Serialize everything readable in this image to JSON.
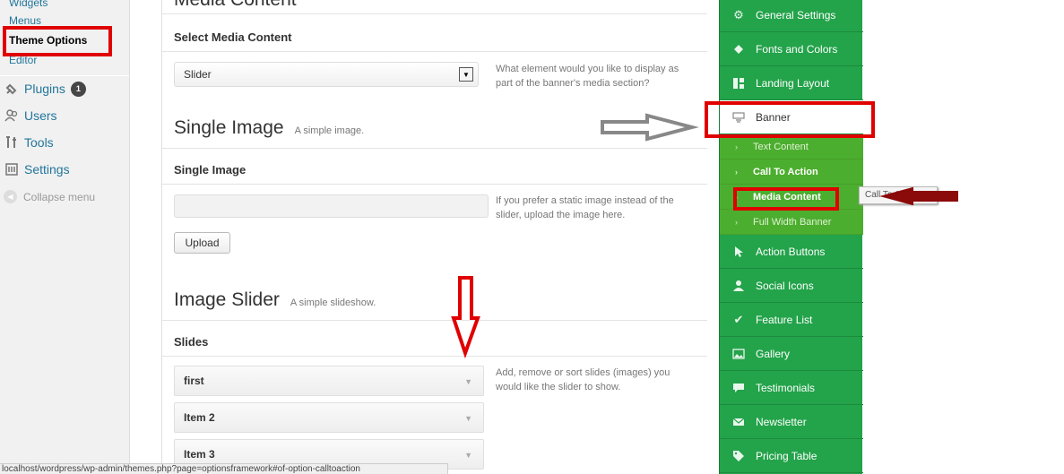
{
  "wp_menu": {
    "sub_items": [
      "Widgets",
      "Menus",
      "Theme Options",
      "Editor"
    ],
    "items": [
      {
        "label": "Plugins",
        "icon": "plug-icon",
        "badge": "1"
      },
      {
        "label": "Users",
        "icon": "users-icon"
      },
      {
        "label": "Tools",
        "icon": "tools-icon"
      },
      {
        "label": "Settings",
        "icon": "settings-icon"
      }
    ],
    "collapse_label": "Collapse menu"
  },
  "content": {
    "heading_top": "Media Content",
    "select_label": "Select Media Content",
    "select_value": "Slider",
    "select_desc": "What element would you like to display as part of the banner's media section?",
    "single_image_title": "Single Image",
    "single_image_sub": "A simple image.",
    "single_image_label": "Single Image",
    "single_image_desc": "If you prefer a static image instead of the slider, upload the image here.",
    "upload_label": "Upload",
    "slider_title": "Image Slider",
    "slider_sub": "A simple slideshow.",
    "slides_label": "Slides",
    "slides_desc": "Add, remove or sort slides (images) you would like the slider to show.",
    "slides": [
      "first",
      "Item 2",
      "Item 3"
    ]
  },
  "options_nav": {
    "items": [
      {
        "label": "General Settings",
        "icon": "gear-icon"
      },
      {
        "label": "Fonts and Colors",
        "icon": "paint-bucket-icon"
      },
      {
        "label": "Landing Layout",
        "icon": "layout-icon"
      },
      {
        "label": "Banner",
        "icon": "banner-icon",
        "active": true
      }
    ],
    "sub_items": [
      "Text Content",
      "Call To Action",
      "Media Content",
      "Full Width Banner"
    ],
    "items_after": [
      {
        "label": "Action Buttons",
        "icon": "cursor-icon"
      },
      {
        "label": "Social Icons",
        "icon": "person-icon"
      },
      {
        "label": "Feature List",
        "icon": "checkmark-icon"
      },
      {
        "label": "Gallery",
        "icon": "image-icon"
      },
      {
        "label": "Testimonials",
        "icon": "speech-bubble-icon"
      },
      {
        "label": "Newsletter",
        "icon": "envelope-icon"
      },
      {
        "label": "Pricing Table",
        "icon": "tag-icon"
      }
    ]
  },
  "tooltip": "Call To Action",
  "status_url": "localhost/wordpress/wp-admin/themes.php?page=optionsframework#of-option-calltoaction",
  "colors": {
    "nav_green": "#23a34a",
    "sub_green": "#4cae2f",
    "annotation_red": "#e00000",
    "link_blue": "#21759b"
  }
}
